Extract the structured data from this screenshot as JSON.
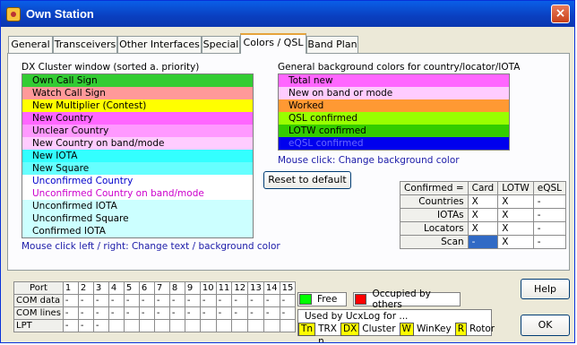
{
  "window": {
    "title": "Own Station",
    "close": "×"
  },
  "tabs": [
    "General",
    "Transceivers",
    "Other Interfaces",
    "Special",
    "Colors / QSL",
    "Band Plan"
  ],
  "dx_cluster": {
    "title": "DX Cluster window (sorted a. priority)",
    "items": [
      {
        "label": "Own Call Sign",
        "bg": "#33cc33",
        "fg": "#000000"
      },
      {
        "label": "Watch Call Sign",
        "bg": "#ff9999",
        "fg": "#000000"
      },
      {
        "label": "New Multiplier (Contest)",
        "bg": "#ffff00",
        "fg": "#000000"
      },
      {
        "label": "New Country",
        "bg": "#ff66ff",
        "fg": "#000000"
      },
      {
        "label": "Unclear Country",
        "bg": "#ff99ff",
        "fg": "#000000"
      },
      {
        "label": "New Country on band/mode",
        "bg": "#ffccff",
        "fg": "#000000"
      },
      {
        "label": "New IOTA",
        "bg": "#33ffff",
        "fg": "#000000"
      },
      {
        "label": "New Square",
        "bg": "#66ffff",
        "fg": "#000000"
      },
      {
        "label": "Unconfirmed Country",
        "bg": "#ffffff",
        "fg": "#0000cc"
      },
      {
        "label": "Unconfirmed Country on band/mode",
        "bg": "#ffffff",
        "fg": "#cc00cc"
      },
      {
        "label": "Unconfirmed IOTA",
        "bg": "#ccffff",
        "fg": "#000000"
      },
      {
        "label": "Unconfirmed Square",
        "bg": "#ccffff",
        "fg": "#000000"
      },
      {
        "label": "Confirmed IOTA",
        "bg": "#ccffff",
        "fg": "#000000"
      }
    ],
    "hint": "Mouse click left / right: Change text / background color"
  },
  "background": {
    "title": "General background colors for country/locator/IOTA",
    "items": [
      {
        "label": "Total new",
        "bg": "#ff66ff",
        "fg": "#000000"
      },
      {
        "label": "New on band or mode",
        "bg": "#ffccff",
        "fg": "#000000"
      },
      {
        "label": "Worked",
        "bg": "#ff9933",
        "fg": "#000000"
      },
      {
        "label": "QSL confirmed",
        "bg": "#99ff00",
        "fg": "#000000"
      },
      {
        "label": "LOTW confirmed",
        "bg": "#33cc00",
        "fg": "#000000"
      },
      {
        "label": "eQSL confirmed",
        "bg": "#0000ee",
        "fg": "#6666ff"
      }
    ],
    "hint": "Mouse click: Change background color"
  },
  "reset_label": "Reset to default",
  "confirmed": {
    "headers": [
      "Confirmed =",
      "Card",
      "LOTW",
      "eQSL"
    ],
    "rows": [
      [
        "Countries",
        "X",
        "X",
        "-"
      ],
      [
        "IOTAs",
        "X",
        "X",
        "-"
      ],
      [
        "Locators",
        "X",
        "X",
        "-"
      ],
      [
        "Scan",
        "-",
        "X",
        "-"
      ]
    ]
  },
  "ports": {
    "headers": [
      "Port",
      "1",
      "2",
      "3",
      "4",
      "5",
      "6",
      "7",
      "8",
      "9",
      "10",
      "11",
      "12",
      "13",
      "14",
      "15"
    ],
    "rows": [
      [
        "COM data",
        "-",
        "-",
        "-",
        "-",
        "-",
        "-",
        "-",
        "-",
        "-",
        "-",
        "-",
        "-",
        "-",
        "-",
        "-"
      ],
      [
        "COM lines",
        "-",
        "-",
        "-",
        "-",
        "-",
        "-",
        "-",
        "-",
        "-",
        "-",
        "-",
        "-",
        "-",
        "-",
        "-"
      ],
      [
        "LPT",
        "-",
        "-",
        "-",
        "",
        "",
        "",
        "",
        "",
        "",
        "",
        "",
        "",
        "",
        "",
        ""
      ]
    ]
  },
  "legend": {
    "free": "Free",
    "occupied": "Occupied by others",
    "free_color": "#00ff00",
    "occupied_color": "#ff0000"
  },
  "used_by": {
    "caption": "Used by UcxLog for ...",
    "items": [
      {
        "key": "Tn",
        "label": "TRX n"
      },
      {
        "key": "DX",
        "label": "Cluster"
      },
      {
        "key": "W",
        "label": "WinKey"
      },
      {
        "key": "R",
        "label": "Rotor"
      }
    ]
  },
  "help_label": "Help",
  "ok_label": "OK"
}
